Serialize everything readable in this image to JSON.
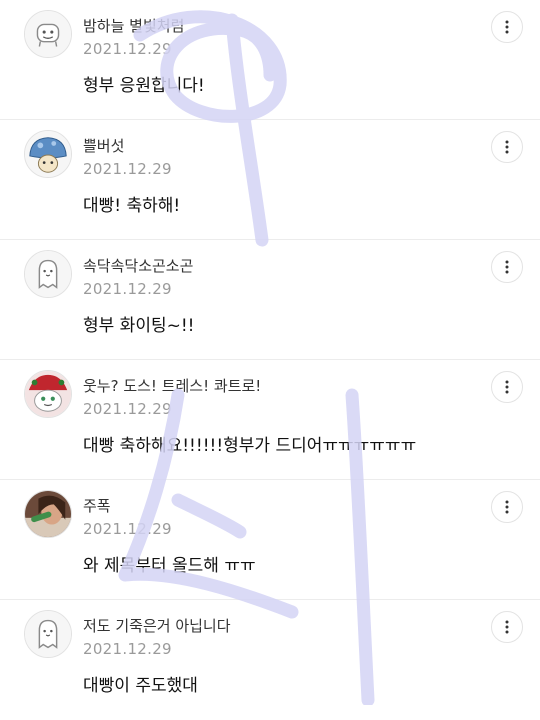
{
  "comments": [
    {
      "nickname": "밤하늘 별빛처럼",
      "date": "2021.12.29",
      "text": "형부 응원합니다!",
      "avatar": "white-character-avatar-icon"
    },
    {
      "nickname": "쁠버섯",
      "date": "2021.12.29",
      "text": "대빵! 축하해!",
      "avatar": "blue-mushroom-avatar-icon"
    },
    {
      "nickname": "속닥속닥소곤소곤",
      "date": "2021.12.29",
      "text": "형부 화이팅~!!",
      "avatar": "ghost-avatar-icon"
    },
    {
      "nickname": "웃누? 도스! 트레스! 콰트로!",
      "date": "2021.12.29",
      "text": "대빵 축하해요!!!!!!형부가 드디어ㅠㅠㅠㅠㅠㅠ",
      "avatar": "santa-character-avatar-icon"
    },
    {
      "nickname": "주폭",
      "date": "2021.12.29",
      "text": "와 제목부터 올드해 ㅠㅠ",
      "avatar": "photo-avatar-icon"
    },
    {
      "nickname": "저도 기죽은거 아닙니다",
      "date": "2021.12.29",
      "text": "대빵이 주도했대",
      "avatar": "ghost-avatar-icon"
    }
  ],
  "icons": {
    "more": "more-vertical-icon"
  },
  "colors": {
    "watermark": "#d4d4f5",
    "date": "#9a9a9a"
  }
}
